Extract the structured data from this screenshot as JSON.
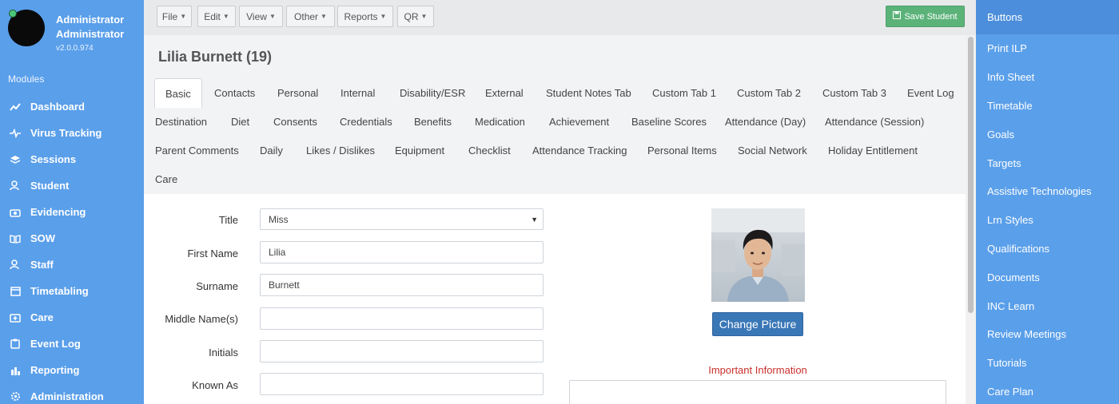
{
  "user": {
    "name": "Administrator Administrator",
    "version": "v2.0.0.974"
  },
  "sidebar": {
    "modules_title": "Modules",
    "items": [
      {
        "label": "Dashboard",
        "icon": "chart-line-icon"
      },
      {
        "label": "Virus Tracking",
        "icon": "heartbeat-icon"
      },
      {
        "label": "Sessions",
        "icon": "layers-icon"
      },
      {
        "label": "Student",
        "icon": "users-icon"
      },
      {
        "label": "Evidencing",
        "icon": "camera-icon"
      },
      {
        "label": "SOW",
        "icon": "book-icon"
      },
      {
        "label": "Staff",
        "icon": "users-icon"
      },
      {
        "label": "Timetabling",
        "icon": "calendar-icon"
      },
      {
        "label": "Care",
        "icon": "first-aid-icon"
      },
      {
        "label": "Event Log",
        "icon": "clipboard-icon"
      },
      {
        "label": "Reporting",
        "icon": "bar-chart-icon"
      },
      {
        "label": "Administration",
        "icon": "gear-icon"
      }
    ]
  },
  "toolbar": {
    "menus": [
      "File",
      "Edit",
      "View",
      "Other",
      "Reports",
      "QR"
    ],
    "save_label": "Save Student"
  },
  "student": {
    "title": "Lilia Burnett (19)"
  },
  "tabs": [
    "Basic",
    "Contacts",
    "Personal",
    "Internal",
    "Disability/ESR",
    "External",
    "Student Notes Tab",
    "Custom Tab 1",
    "Custom Tab 2",
    "Custom Tab 3",
    "Event Log",
    "Destination",
    "Diet",
    "Consents",
    "Credentials",
    "Benefits",
    "Medication",
    "Achievement",
    "Baseline Scores",
    "Attendance (Day)",
    "Attendance (Session)",
    "Parent Comments",
    "Daily",
    "Likes / Dislikes",
    "Equipment",
    "Checklist",
    "Attendance Tracking",
    "Personal Items",
    "Social Network",
    "Holiday Entitlement",
    "Care"
  ],
  "active_tab": "Basic",
  "form": {
    "title_label": "Title",
    "title_value": "Miss",
    "first_name_label": "First Name",
    "first_name_value": "Lilia",
    "surname_label": "Surname",
    "surname_value": "Burnett",
    "middle_name_label": "Middle Name(s)",
    "middle_name_value": "",
    "initials_label": "Initials",
    "initials_value": "",
    "known_as_label": "Known As",
    "known_as_value": ""
  },
  "photo": {
    "change_label": "Change Picture"
  },
  "important_info_label": "Important Information",
  "right_panel": {
    "title": "Buttons",
    "items": [
      "Print ILP",
      "Info Sheet",
      "Timetable",
      "Goals",
      "Targets",
      "Assistive Technologies",
      "Lrn Styles",
      "Qualifications",
      "Documents",
      "INC Learn",
      "Review Meetings",
      "Tutorials",
      "Care Plan"
    ]
  },
  "colors": {
    "sidebar": "#5a9fea",
    "save": "#5cb37a",
    "primary": "#3a77b7",
    "danger": "#c9302c"
  }
}
